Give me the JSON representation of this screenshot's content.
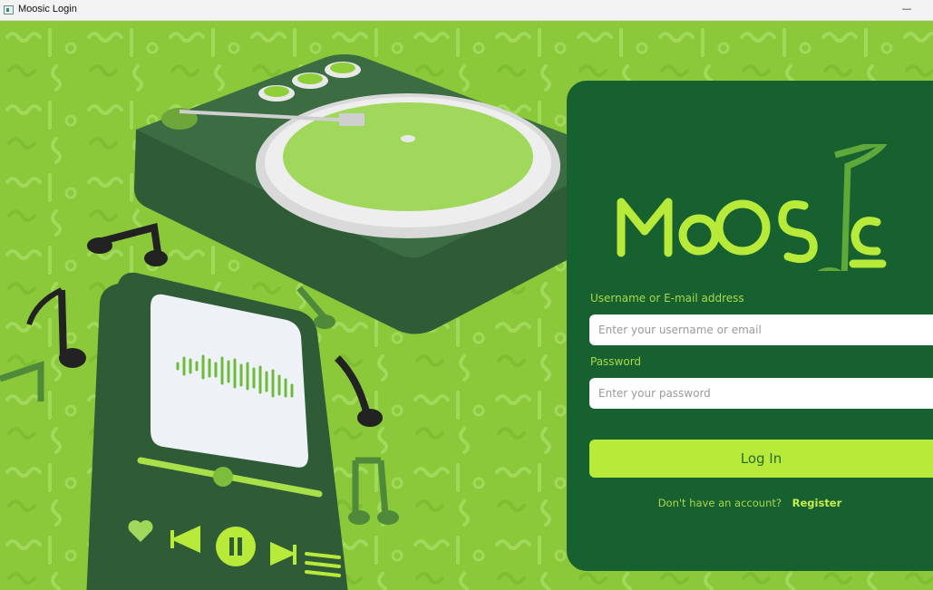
{
  "window": {
    "title": "Moosic Login",
    "minimize_glyph": "—",
    "app_icon": "app-window-icon"
  },
  "brand": {
    "logo_text": "MOOSIC",
    "logo_icon": "music-note-icon"
  },
  "login": {
    "username_label": "Username or E-mail address",
    "username_placeholder": "Enter your username or email",
    "username_value": "",
    "password_label": "Password",
    "password_placeholder": "Enter your password",
    "password_value": "",
    "submit_label": "Log In",
    "register_prompt": "Don't have an account?",
    "register_link": "Register"
  },
  "illustration": {
    "player_icons": [
      "heart-icon",
      "previous-icon",
      "pause-icon",
      "next-icon",
      "playlist-icon"
    ],
    "decor_icons": [
      "turntable-illustration",
      "music-note-icon",
      "waveform-icon"
    ]
  },
  "colors": {
    "background": "#8bc83a",
    "panel": "#17602f",
    "accent": "#b8ea3a",
    "label": "#a9d94a"
  }
}
